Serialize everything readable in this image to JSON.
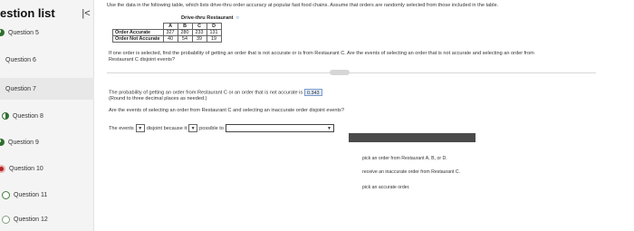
{
  "sidebar": {
    "title": "estion list",
    "collapse_glyph": "|<",
    "items": [
      {
        "label": "Question 5",
        "status": "partial"
      },
      {
        "label": "Question 6",
        "status": "none"
      },
      {
        "label": "Question 7",
        "status": "none"
      },
      {
        "label": "Question 8",
        "status": "half"
      },
      {
        "label": "Question 9",
        "status": "partial"
      },
      {
        "label": "Question 10",
        "status": "incorrect"
      },
      {
        "label": "Question 11",
        "status": "empty"
      },
      {
        "label": "Question 12",
        "status": "empty"
      }
    ]
  },
  "main": {
    "intro": "Use the data in the following table, which lists drive-thru order accuracy at popular fast food chains. Assume that orders are randomly selected from those included in the table.",
    "table": {
      "caption": "Drive-thru Restaurant",
      "columns": [
        "A",
        "B",
        "C",
        "D"
      ],
      "rows": [
        {
          "label": "Order Accurate",
          "values": [
            "327",
            "280",
            "233",
            "131"
          ]
        },
        {
          "label": "Order Not Accurate",
          "values": [
            "40",
            "54",
            "39",
            "19"
          ]
        }
      ]
    },
    "question": "If one order is selected, find the probability of getting an order that is not accurate or is from Restaurant C. Are the events of selecting an order that is not accurate and selecting an order from Restaurant C disjoint events?",
    "part1_text": "The probability of getting an order from Restaurant C or an order that is not accurate is",
    "part1_answer": "0.343",
    "part1_note": "(Round to three decimal places as needed.)",
    "part2_text": "Are the events of selecting an order from Restaurant C and selecting an inaccurate order disjoint events?",
    "fill": {
      "prefix": "The events",
      "middle": "disjoint because it",
      "suffix": "possible to"
    },
    "dropdown_options": [
      "pick an order from Restaurant A, B, or D.",
      "receive an inaccurate order from Restaurant C.",
      "pick an accurate order."
    ]
  }
}
